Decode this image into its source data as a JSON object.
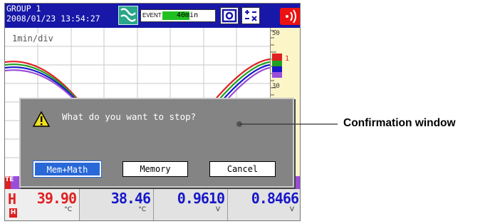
{
  "header": {
    "group": "GROUP 1",
    "datetime": "2008/01/23 13:54:27",
    "event_label": "EVENT",
    "event_time": "40min",
    "icons": [
      "memory-sample-icon",
      "display-icon",
      "math-icon",
      "alarm-icon"
    ]
  },
  "trend": {
    "div_label": "1min/div",
    "scale": {
      "top": "50",
      "mid": "30"
    },
    "channel_marker": "1"
  },
  "dialog": {
    "message": "What do you want to stop?",
    "buttons": {
      "mem_math": "Mem+Math",
      "memory": "Memory",
      "cancel": "Cancel"
    },
    "selected": "Mem+Math"
  },
  "digital": {
    "tag": "TE",
    "status_letter": "H",
    "alarm_badge": "H",
    "cells": [
      {
        "value": "39.90",
        "unit": "°C",
        "color": "#e02020"
      },
      {
        "value": "38.46",
        "unit": "°C",
        "color": "#1818c8"
      },
      {
        "value": "0.9610",
        "unit": "V",
        "color": "#1818c8"
      },
      {
        "value": "0.8466",
        "unit": "V",
        "color": "#1818c8"
      }
    ]
  },
  "callout": {
    "label": "Confirmation window"
  },
  "colors": {
    "header": "#1717a8",
    "selected_button": "#2868d8",
    "dialog": "#848484",
    "scale_panel": "#fcf5c8"
  }
}
